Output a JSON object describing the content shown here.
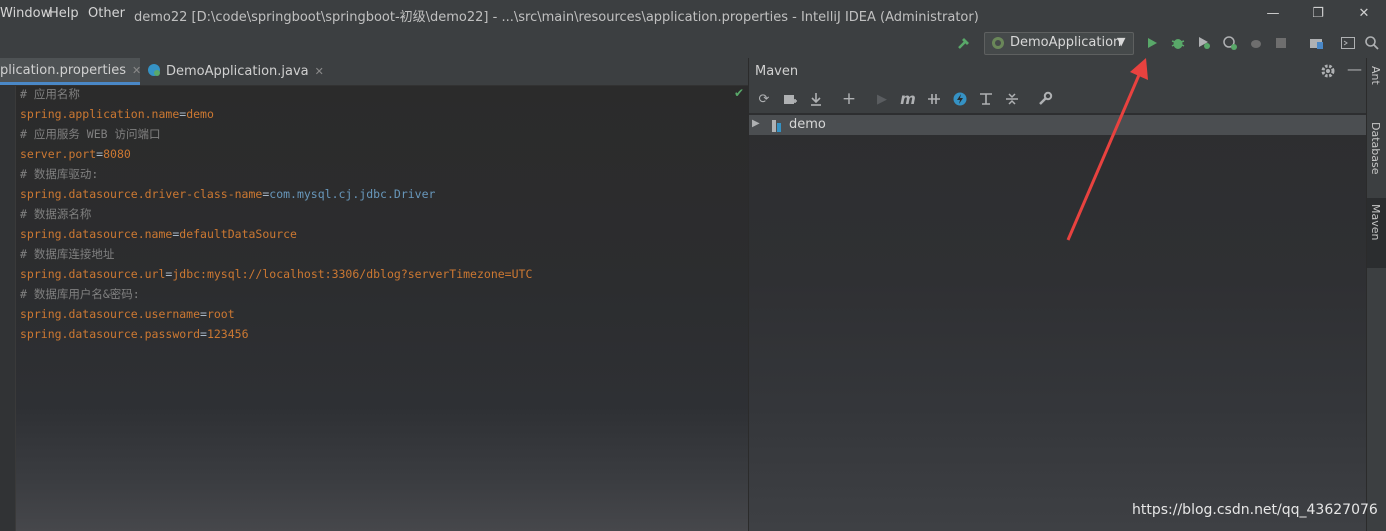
{
  "menu": [
    "Window",
    "Help",
    "Other"
  ],
  "window_title": "demo22 [D:\\code\\springboot\\springboot-初级\\demo22] - ...\\src\\main\\resources\\application.properties - IntelliJ IDEA (Administrator)",
  "toolbar": {
    "run_config": "DemoApplication"
  },
  "tabs": [
    {
      "label": "plication.properties",
      "active": true
    },
    {
      "label": "DemoApplication.java",
      "active": false
    }
  ],
  "editor": {
    "lines": [
      {
        "comment": "# 应用名称"
      },
      {
        "key": "spring.application.name",
        "eq": "=",
        "value": "demo"
      },
      {
        "comment": "# 应用服务 WEB 访问端口"
      },
      {
        "key": "server.port",
        "eq": "=",
        "value": "8080"
      },
      {
        "comment": "# 数据库驱动:"
      },
      {
        "key": "spring.datasource.driver-class-name",
        "eq": "=",
        "value": "com.mysql.cj.jdbc.Driver"
      },
      {
        "comment": "# 数据源名称"
      },
      {
        "key": "spring.datasource.name",
        "eq": "=",
        "value": "defaultDataSource"
      },
      {
        "comment": "# 数据库连接地址"
      },
      {
        "key": "spring.datasource.url",
        "eq": "=",
        "value": "jdbc:mysql://localhost:3306/dblog?serverTimezone=UTC"
      },
      {
        "comment": "# 数据库用户名&密码:"
      },
      {
        "key": "spring.datasource.username",
        "eq": "=",
        "value": "root"
      },
      {
        "key": "spring.datasource.password",
        "eq": "=",
        "value": "123456"
      }
    ]
  },
  "maven": {
    "title": "Maven",
    "tree": [
      {
        "label": "demo"
      }
    ]
  },
  "right_stripe": [
    "Ant",
    "Database",
    "Maven"
  ],
  "watermark": "https://blog.csdn.net/qq_43627076",
  "colors": {
    "run": "#59a869",
    "debug": "#59a869",
    "annotation_arrow": "#e8423f",
    "accent_tab": "#4a88c7"
  }
}
